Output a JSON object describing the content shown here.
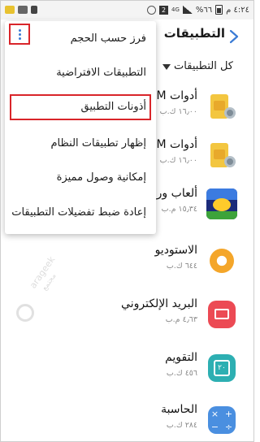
{
  "status_bar": {
    "time": "٤:٢٤ م",
    "battery": "%٦٦",
    "network": "4G"
  },
  "app_bar": {
    "title": "التطبيقات"
  },
  "filter": {
    "label": "كل التطبيقات"
  },
  "apps": [
    {
      "name": "أدوات M",
      "size": "١٦٫٠٠ ك.ب",
      "icon": "sim-toolkit-icon"
    },
    {
      "name": "أدوات M",
      "size": "١٦٫٠٠ ك.ب",
      "icon": "sim-toolkit-icon"
    },
    {
      "name": "ألعاب ور",
      "size": "١٥٫٣٤ م.ب",
      "icon": "game-icon"
    },
    {
      "name": "الاستوديو",
      "size": "٦٤٤ ك.ب",
      "icon": "studio-icon"
    },
    {
      "name": "البريد الإلكتروني",
      "size": "٤٫٦٣ م.ب",
      "icon": "email-icon"
    },
    {
      "name": "التقويم",
      "size": "٤٥٦ ك.ب",
      "icon": "calendar-icon"
    },
    {
      "name": "الحاسبة",
      "size": "٢٨٤ ك.ب",
      "icon": "calculator-icon"
    }
  ],
  "menu": {
    "items": [
      "فرز حسب الحجم",
      "التطبيقات الافتراضية",
      "أذونات التطبيق",
      "إظهار تطبيقات النظام",
      "إمكانية وصول مميزة",
      "إعادة ضبط تفضيلات التطبيقات"
    ]
  },
  "calendar_day": "٢٠",
  "watermark": {
    "line1": "arageek",
    "line2": "مجتمع"
  },
  "colors": {
    "accent": "#3a7bd5",
    "highlight": "#d9252a"
  }
}
